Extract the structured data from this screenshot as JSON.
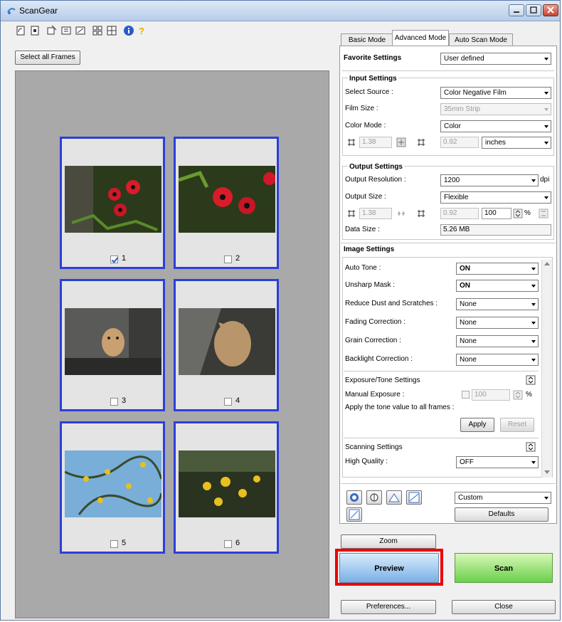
{
  "window": {
    "title": "ScanGear",
    "colors": {
      "accent": "#2c3fd8",
      "highlight": "#e00000",
      "preview_btn": "#79b0e6",
      "scan_btn": "#6ad04a"
    }
  },
  "toolbar": {
    "select_all_frames": "Select all Frames"
  },
  "frames": [
    {
      "number": "1",
      "checked": true
    },
    {
      "number": "2",
      "checked": false
    },
    {
      "number": "3",
      "checked": false
    },
    {
      "number": "4",
      "checked": false
    },
    {
      "number": "5",
      "checked": false
    },
    {
      "number": "6",
      "checked": false
    }
  ],
  "tabs": [
    {
      "label": "Basic Mode"
    },
    {
      "label": "Advanced Mode"
    },
    {
      "label": "Auto Scan Mode"
    }
  ],
  "favorite": {
    "label": "Favorite Settings",
    "value": "User defined"
  },
  "input_settings": {
    "title": "Input Settings",
    "select_source_label": "Select Source :",
    "select_source_value": "Color Negative Film",
    "film_size_label": "Film Size :",
    "film_size_value": "35mm Strip",
    "color_mode_label": "Color Mode :",
    "color_mode_value": "Color",
    "width_value": "1.38",
    "height_value": "0.92",
    "unit_value": "inches"
  },
  "output_settings": {
    "title": "Output Settings",
    "resolution_label": "Output Resolution :",
    "resolution_value": "1200",
    "resolution_unit": "dpi",
    "size_label": "Output Size :",
    "size_value": "Flexible",
    "width_value": "1.38",
    "height_value": "0.92",
    "scale_value": "100",
    "scale_unit": "%",
    "data_size_label": "Data Size :",
    "data_size_value": "5.26 MB"
  },
  "image_settings": {
    "title": "Image Settings",
    "rows": [
      {
        "label": "Auto Tone :",
        "value": "ON"
      },
      {
        "label": "Unsharp Mask :",
        "value": "ON"
      },
      {
        "label": "Reduce Dust and Scratches :",
        "value": "None"
      },
      {
        "label": "Fading Correction :",
        "value": "None"
      },
      {
        "label": "Grain Correction :",
        "value": "None"
      },
      {
        "label": "Backlight Correction :",
        "value": "None"
      }
    ],
    "exposure_title": "Exposure/Tone Settings",
    "manual_exposure_label": "Manual Exposure :",
    "manual_exposure_value": "100",
    "manual_exposure_unit": "%",
    "apply_all_label": "Apply the tone value to all frames :",
    "apply_button": "Apply",
    "reset_button": "Reset",
    "scanning_title": "Scanning Settings",
    "high_quality_label": "High Quality :",
    "high_quality_value": "OFF"
  },
  "tools": {
    "custom_value": "Custom",
    "defaults_button": "Defaults"
  },
  "buttons": {
    "zoom": "Zoom",
    "preview": "Preview",
    "scan": "Scan",
    "preferences": "Preferences...",
    "close": "Close"
  }
}
